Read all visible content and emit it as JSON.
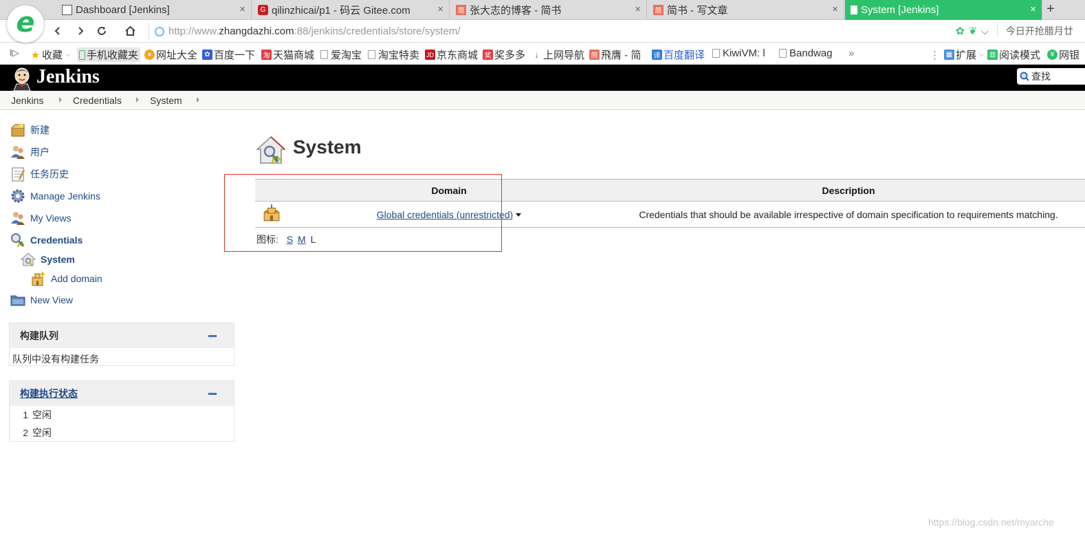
{
  "browser": {
    "logo_letter": "e",
    "tabs": [
      {
        "label": "Dashboard [Jenkins]",
        "active": false
      },
      {
        "label": "qilinzhicai/p1 - 码云 Gitee.com",
        "active": false
      },
      {
        "label": "张大志的博客 - 简书",
        "active": false
      },
      {
        "label": "简书 - 写文章",
        "active": false
      },
      {
        "label": "System [Jenkins]",
        "active": true
      }
    ],
    "close_glyph": "×",
    "new_tab_glyph": "+",
    "url_prefix": "http://www.",
    "url_host": "zhangdazhi.com",
    "url_rest": ":88/jenkins/credentials/store/system/",
    "promo_text": "今日开抢腊月廿",
    "accent_color": "#2ec16b"
  },
  "bookmarks": {
    "toggle_glyph": "I▷",
    "items": [
      {
        "label": "收藏",
        "icon": "star-icon"
      },
      {
        "label": "手机收藏夹",
        "icon": "phone-icon"
      },
      {
        "label": "网址大全",
        "icon": "nav-icon"
      },
      {
        "label": "百度一下",
        "icon": "baidu-icon"
      },
      {
        "label": "天猫商城",
        "icon": "tmall-icon"
      },
      {
        "label": "爱淘宝",
        "icon": "page-icon"
      },
      {
        "label": "淘宝特卖",
        "icon": "page-icon"
      },
      {
        "label": "京东商城",
        "icon": "jd-icon"
      },
      {
        "label": "奖多多",
        "icon": "prize-icon"
      },
      {
        "label": "上网导航",
        "icon": "hao-icon"
      },
      {
        "label": "飛膺 - 简",
        "icon": "jianshu-icon"
      },
      {
        "label": "百度翻译",
        "icon": "translate-icon"
      },
      {
        "label": "KiwiVM: l",
        "icon": "page-icon"
      },
      {
        "label": "Bandwag",
        "icon": "page-icon"
      }
    ],
    "more": "»",
    "extensions": "扩展",
    "reading_mode": "阅读模式",
    "online_bank": "网银"
  },
  "jenkins": {
    "title": "Jenkins",
    "search_placeholder": "查找"
  },
  "breadcrumbs": [
    "Jenkins",
    "Credentials",
    "System"
  ],
  "sidebar": {
    "tasks": [
      {
        "label": "新建",
        "icon": "new-item-icon"
      },
      {
        "label": "用户",
        "icon": "people-icon"
      },
      {
        "label": "任务历史",
        "icon": "notepad-icon"
      },
      {
        "label": "Manage Jenkins",
        "icon": "gear-icon"
      },
      {
        "label": "My Views",
        "icon": "user-icon"
      },
      {
        "label": "Credentials",
        "icon": "credentials-icon"
      },
      {
        "label": "System",
        "icon": "system-store-icon"
      },
      {
        "label": "Add domain",
        "icon": "domain-icon"
      },
      {
        "label": "New View",
        "icon": "folder-icon"
      }
    ]
  },
  "build_queue": {
    "title": "构建队列",
    "empty_text": "队列中没有构建任务"
  },
  "executors": {
    "title": "构建执行状态",
    "rows": [
      {
        "num": "1",
        "state": "空闲"
      },
      {
        "num": "2",
        "state": "空闲"
      }
    ]
  },
  "main": {
    "title": "System",
    "table": {
      "headers": [
        "Domain",
        "Description"
      ],
      "rows": [
        {
          "domain": "Global credentials (unrestricted)",
          "description": "Credentials that should be available irrespective of domain specification to requirements matching."
        }
      ]
    },
    "icon_size_label": "图标:",
    "icon_sizes": [
      "S",
      "M",
      "L"
    ]
  },
  "watermark": "https://blog.csdn.net/myarche"
}
